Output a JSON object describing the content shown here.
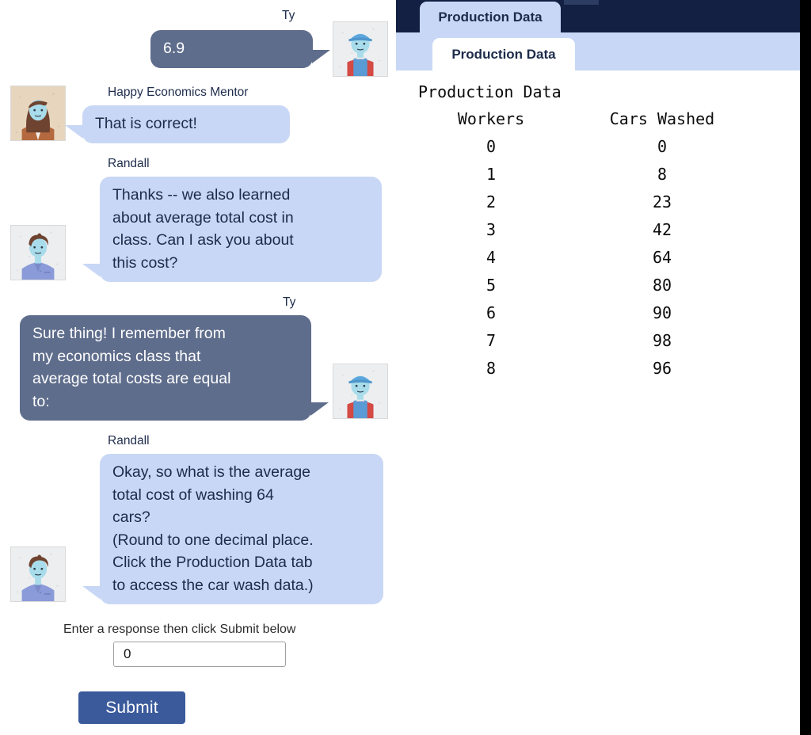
{
  "chat": {
    "messages": [
      {
        "speaker": "Ty",
        "side": "right",
        "text": "6.9",
        "avatar": "worker-avatar"
      },
      {
        "speaker": "Happy Economics Mentor",
        "side": "left",
        "text": "That is correct!",
        "avatar": "mentor-avatar"
      },
      {
        "speaker": "Randall",
        "side": "left",
        "text": "Thanks -- we also learned\nabout average total cost in\nclass.  Can I ask you about\nthis cost?",
        "avatar": "student-avatar"
      },
      {
        "speaker": "Ty",
        "side": "right",
        "text": "Sure thing!  I remember from\nmy economics class that\naverage total costs are equal\nto:",
        "avatar": "worker-avatar"
      },
      {
        "speaker": "Randall",
        "side": "left",
        "text": "Okay, so what is the average\ntotal cost of washing 64\ncars?\n(Round to one decimal place.\nClick the Production Data tab\nto access the car wash data.)",
        "avatar": "student-avatar"
      }
    ]
  },
  "answer": {
    "prompt_label": "Enter a response then click Submit below",
    "input_value": "0",
    "input_placeholder": "",
    "submit_label": "Submit"
  },
  "data_pane": {
    "outer_tab_label": "Production Data",
    "inner_tab_label": "Production Data"
  },
  "chart_data": {
    "type": "table",
    "title": "Production Data",
    "columns": [
      "Workers",
      "Cars Washed"
    ],
    "rows": [
      [
        "0",
        "0"
      ],
      [
        "1",
        "8"
      ],
      [
        "2",
        "23"
      ],
      [
        "3",
        "42"
      ],
      [
        "4",
        "64"
      ],
      [
        "5",
        "80"
      ],
      [
        "6",
        "90"
      ],
      [
        "7",
        "98"
      ],
      [
        "8",
        "96"
      ]
    ],
    "xlabel": "Workers",
    "ylabel": "Cars Washed"
  },
  "colors": {
    "bubble_left": "#c8d7f5",
    "bubble_right": "#5f6d8c",
    "tabbar_dark": "#132043",
    "tabbar_light": "#c8d7f5",
    "submit": "#3a5a9b",
    "text_navy": "#1c2b4a"
  }
}
